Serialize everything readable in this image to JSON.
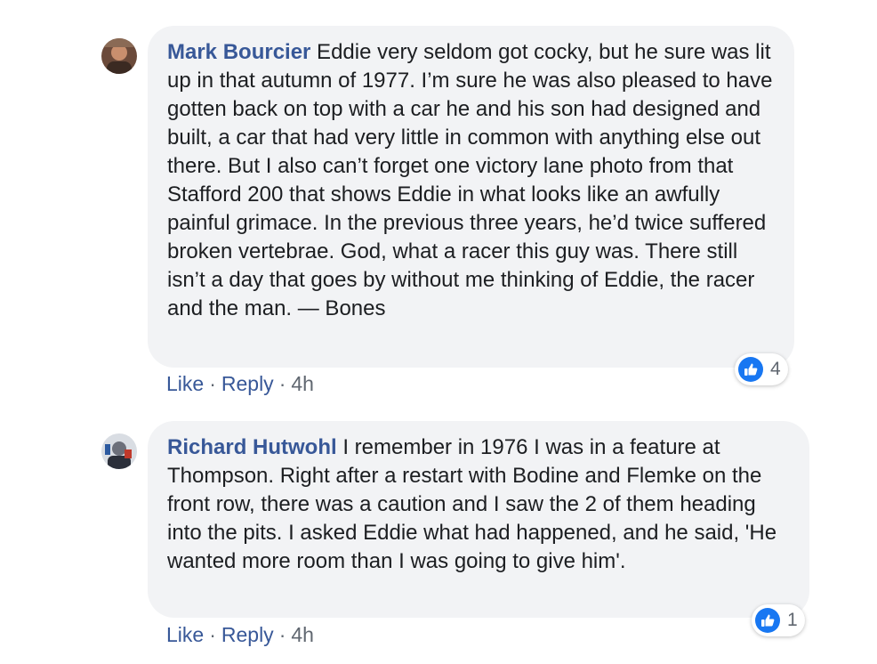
{
  "comments": [
    {
      "author": "Mark Bourcier",
      "text": " Eddie very seldom got cocky, but he sure was lit up in that autumn of 1977. I’m sure he was also pleased to have gotten back on top with a car he and his son had designed and built, a car that had very little in common with anything else out there. But I also can’t forget one victory lane photo from that Stafford 200 that shows Eddie in what looks like an awfully painful grimace. In the previous three years, he’d twice suffered broken vertebrae. God, what a racer this guy was. There still isn’t a day that goes by without me thinking of Eddie, the racer and the man. — Bones",
      "reaction_icon": "like-icon",
      "reaction_count": "4",
      "like_label": "Like",
      "reply_label": "Reply",
      "separator": "·",
      "time": "4h"
    },
    {
      "author": "Richard Hutwohl",
      "text": " I remember in 1976 I was in a feature at Thompson. Right after a restart with Bodine and Flemke on the front row, there was a caution and I saw the 2 of them heading into the pits. I asked Eddie what had happened, and he said, 'He wanted more room than I was going to give him'.",
      "reaction_icon": "like-icon",
      "reaction_count": "1",
      "like_label": "Like",
      "reply_label": "Reply",
      "separator": "·",
      "time": "4h"
    }
  ],
  "colors": {
    "author": "#385898",
    "bubble": "#f2f3f5",
    "like_blue": "#1877f2",
    "meta": "#606770"
  }
}
